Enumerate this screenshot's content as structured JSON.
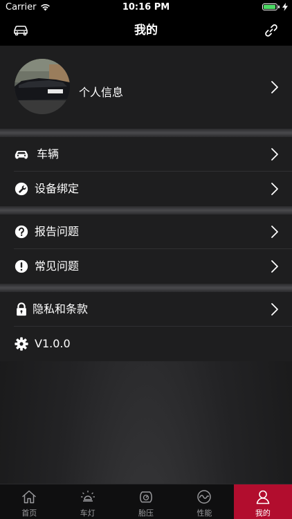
{
  "status_bar": {
    "carrier": "Carrier",
    "time": "10:16 PM",
    "battery_level": 0.95
  },
  "nav": {
    "title": "我的",
    "left_icon": "car-icon",
    "right_icon": "link-icon"
  },
  "profile": {
    "label": "个人信息",
    "avatar_icon": "car-photo"
  },
  "menu": {
    "vehicle": {
      "label": "车辆",
      "icon": "car-icon"
    },
    "device_binding": {
      "label": "设备绑定",
      "icon": "wrench-icon"
    },
    "report_issue": {
      "label": "报告问题",
      "icon": "question-icon"
    },
    "faq": {
      "label": "常见问题",
      "icon": "exclamation-icon"
    },
    "privacy": {
      "label": "隐私和条款",
      "icon": "lock-icon"
    },
    "version": {
      "label": "V1.0.0",
      "icon": "gear-icon"
    }
  },
  "tab_bar": {
    "tabs": [
      {
        "label": "首页",
        "icon": "home-icon"
      },
      {
        "label": "车灯",
        "icon": "light-icon"
      },
      {
        "label": "胎压",
        "icon": "tire-pressure-icon"
      },
      {
        "label": "性能",
        "icon": "performance-icon"
      },
      {
        "label": "我的",
        "icon": "user-icon",
        "active": true
      }
    ]
  },
  "colors": {
    "accent": "#b20d2e",
    "background": "#1e1e1f",
    "battery": "#4cd964"
  }
}
